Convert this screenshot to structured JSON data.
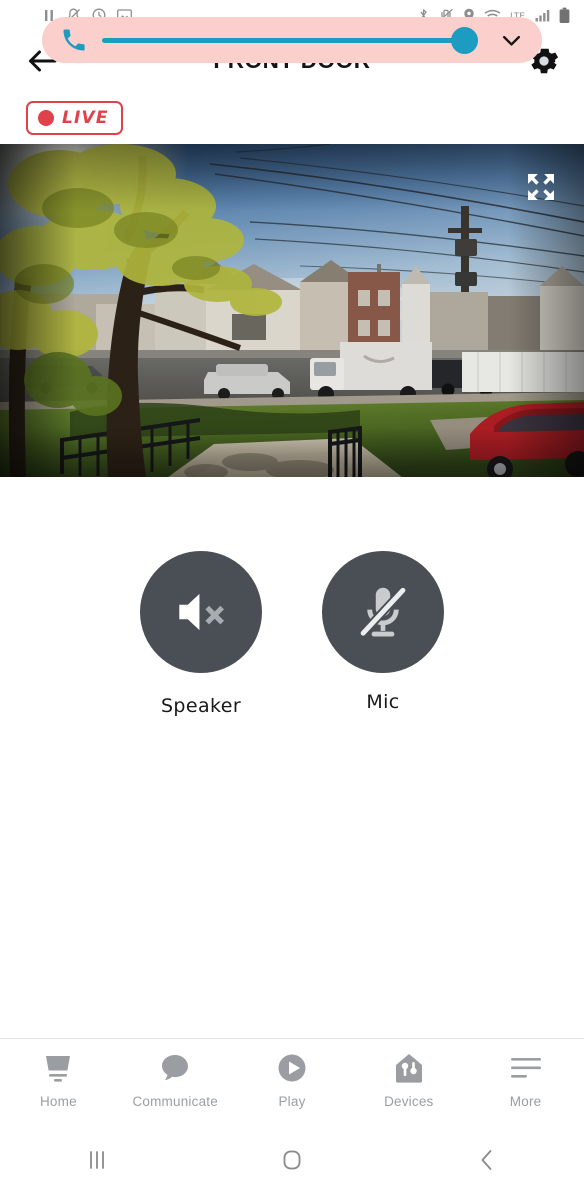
{
  "status_bar": {
    "left_icons": [
      "pause-icon",
      "bell-mute-icon",
      "clock-icon",
      "image-icon"
    ],
    "right_icons": [
      "bluetooth-icon",
      "vibrate-mute-icon",
      "location-icon",
      "wifi-icon",
      "lte-icon",
      "signal-bars-icon",
      "battery-icon"
    ]
  },
  "volume_overlay": {
    "call_icon": "phone-call-icon",
    "slider_value": 100,
    "slider_max": 100,
    "expand_icon": "chevron-down-icon",
    "pill_color": "#fbcfcb",
    "slider_color": "#1b9cc0"
  },
  "header": {
    "back_icon": "back-arrow-icon",
    "title": "FRONT DOOR",
    "settings_icon": "gear-icon"
  },
  "live": {
    "label": "LIVE",
    "color": "#e0414a"
  },
  "video": {
    "expand_icon": "fullscreen-expand-icon",
    "scene": "Front door camera live view: suburban street, houses, parked cars, red sedan, white box truck, front yard with walkway and black railings"
  },
  "controls": [
    {
      "id": "speaker",
      "label": "Speaker",
      "icon": "speaker-mute-icon",
      "state": "muted",
      "circle_color": "#4a4f55"
    },
    {
      "id": "mic",
      "label": "Mic",
      "icon": "mic-mute-icon",
      "state": "muted",
      "circle_color": "#4a4f55"
    }
  ],
  "tabbar": {
    "items": [
      {
        "label": "Home",
        "icon": "home-screen-icon"
      },
      {
        "label": "Communicate",
        "icon": "speech-bubble-icon"
      },
      {
        "label": "Play",
        "icon": "play-circle-icon"
      },
      {
        "label": "Devices",
        "icon": "house-devices-icon"
      },
      {
        "label": "More",
        "icon": "more-lines-icon"
      }
    ],
    "inactive_color": "#9a9ea2"
  },
  "android_nav": {
    "recents_icon": "recents-icon",
    "home_icon": "home-circle-icon",
    "back_icon": "nav-back-icon"
  }
}
